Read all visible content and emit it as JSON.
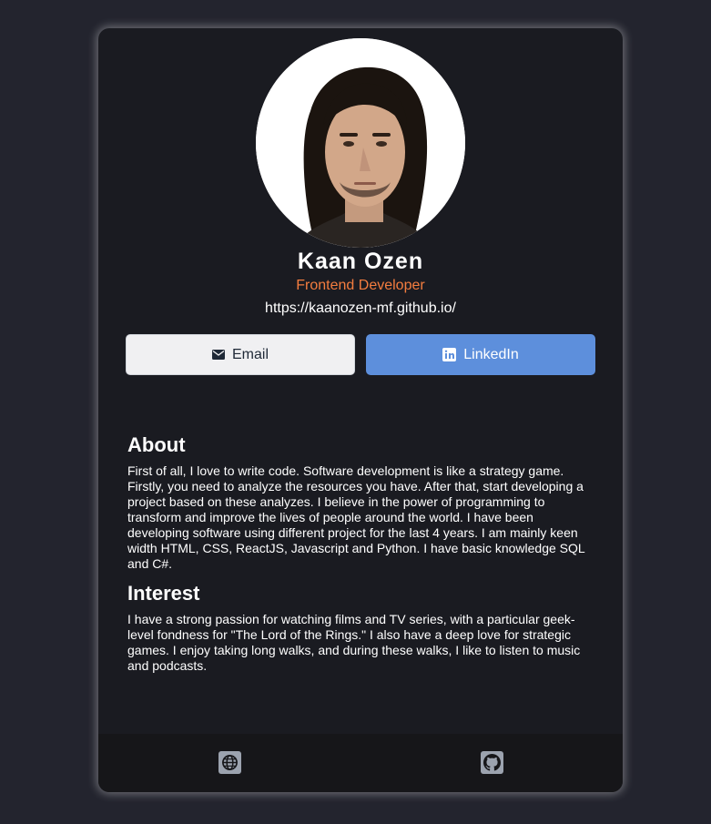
{
  "profile": {
    "name": "Kaan Ozen",
    "title": "Frontend Developer",
    "website": "https://kaanozen-mf.github.io/"
  },
  "buttons": {
    "email_label": "Email",
    "linkedin_label": "LinkedIn"
  },
  "about": {
    "heading": "About",
    "text": "First of all, I love to write code. Software development is like a strategy game. Firstly, you need to analyze the resources you have. After that, start developing a project based on these analyzes. I believe in the power of programming to transform and improve the lives of people around the world. I have been developing software using different project for the last 4 years. I am mainly keen width HTML, CSS, ReactJS, Javascript and Python. I have basic knowledge SQL and C#."
  },
  "interest": {
    "heading": "Interest",
    "text": "I have a strong passion for watching films and TV series, with a particular geek-level fondness for \"The Lord of the Rings.\" I also have a deep love for strategic games. I enjoy taking long walks, and during these walks, I like to listen to music and podcasts."
  },
  "footer": {
    "icons": [
      "globe-icon",
      "github-icon"
    ]
  },
  "colors": {
    "page_background": "#23242e",
    "card_background": "#1a1b21",
    "accent": "#f47d3f",
    "linkedin": "#5d8fdc",
    "footer_background": "#161619"
  }
}
